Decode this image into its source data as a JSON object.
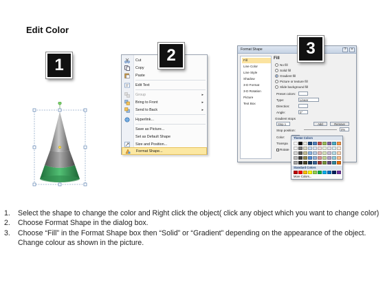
{
  "page": {
    "title": "Edit Color"
  },
  "badges": [
    "1",
    "2",
    "3"
  ],
  "colors": {
    "badge_bg": "#111111",
    "cone_grey": "#8a8a8a",
    "cone_green": "#3aa05a",
    "menu_highlight": "#fce8a2"
  },
  "context_menu": {
    "items": [
      {
        "label": "Cut",
        "icon": "scissors-icon",
        "disabled": false,
        "submenu": false
      },
      {
        "label": "Copy",
        "icon": "copy-icon",
        "disabled": false,
        "submenu": false
      },
      {
        "label": "Paste",
        "icon": "paste-icon",
        "disabled": false,
        "submenu": false
      },
      {
        "label": "Edit Text",
        "icon": "edit-text-icon",
        "disabled": false,
        "submenu": false
      },
      {
        "label": "Group",
        "icon": "group-icon",
        "disabled": true,
        "submenu": true
      },
      {
        "label": "Bring to Front",
        "icon": "bring-front-icon",
        "disabled": false,
        "submenu": true
      },
      {
        "label": "Send to Back",
        "icon": "send-back-icon",
        "disabled": false,
        "submenu": true
      },
      {
        "label": "Hyperlink...",
        "icon": "hyperlink-icon",
        "disabled": false,
        "submenu": false
      },
      {
        "label": "Save as Picture...",
        "icon": "",
        "disabled": false,
        "submenu": false
      },
      {
        "label": "Set as Default Shape",
        "icon": "",
        "disabled": false,
        "submenu": false
      },
      {
        "label": "Size and Position...",
        "icon": "size-icon",
        "disabled": false,
        "submenu": false
      },
      {
        "label": "Format Shape...",
        "icon": "format-shape-icon",
        "disabled": false,
        "submenu": false,
        "highlight": true
      }
    ]
  },
  "dialog": {
    "title": "Format Shape",
    "categories": [
      "Fill",
      "Line Color",
      "Line Style",
      "Shadow",
      "3-D Format",
      "3-D Rotation",
      "Picture",
      "Text Box"
    ],
    "active_category": "Fill",
    "fill_heading": "Fill",
    "fill_options": [
      "No fill",
      "Solid fill",
      "Gradient fill",
      "Picture or texture fill",
      "Slide background fill"
    ],
    "selected_fill": "Gradient fill",
    "preset_colors_label": "Preset colors:",
    "type_label": "Type:",
    "type_value": "Linear",
    "direction_label": "Direction:",
    "angle_label": "Angle:",
    "angle_value": "0°",
    "gradient_stops_label": "Gradient stops",
    "stop_value": "Stop 1",
    "add_label": "Add",
    "remove_label": "Remove",
    "stop_position_label": "Stop position:",
    "stop_position_value": "0%",
    "color_label": "Color:",
    "transparency_label": "Transpa",
    "rotate_label": "Rotate"
  },
  "palette": {
    "theme_label": "Theme Colors",
    "standard_label": "Standard Colors",
    "more_label": "More Colors...",
    "theme_top": [
      "#ffffff",
      "#000000",
      "#eeece1",
      "#1f497d",
      "#4f81bd",
      "#c0504d",
      "#9bbb59",
      "#8064a2",
      "#4bacc6",
      "#f79646"
    ],
    "theme_shades": [
      [
        "#f2f2f2",
        "#7f7f7f",
        "#ddd9c3",
        "#c6d9f0",
        "#dbe5f1",
        "#f2dcdb",
        "#ebf1dd",
        "#e5e0ec",
        "#dbeef3",
        "#fdeada"
      ],
      [
        "#d8d8d8",
        "#595959",
        "#c4bd97",
        "#8db3e2",
        "#b8cce4",
        "#e5b9b7",
        "#d7e3bc",
        "#ccc1d9",
        "#b7dde8",
        "#fbd5b5"
      ],
      [
        "#bfbfbf",
        "#3f3f3f",
        "#938953",
        "#548dd4",
        "#95b3d7",
        "#d99694",
        "#c3d69b",
        "#b2a2c7",
        "#92cddc",
        "#fac08f"
      ],
      [
        "#a5a5a5",
        "#262626",
        "#494429",
        "#17365d",
        "#366092",
        "#953734",
        "#76923c",
        "#5f497a",
        "#31859b",
        "#e36c09"
      ]
    ],
    "standard": [
      "#c00000",
      "#ff0000",
      "#ffc000",
      "#ffff00",
      "#92d050",
      "#00b050",
      "#00b0f0",
      "#0070c0",
      "#002060",
      "#7030a0"
    ]
  },
  "instructions": [
    {
      "num": "1.",
      "text": "Select the shape to change the color and Right click the object( click any object which you want to change color)"
    },
    {
      "num": "2.",
      "text": "Choose Format Shape in the dialog box."
    },
    {
      "num": "3.",
      "text": "Choose “Fill” in the Format Shape box then “Solid” or “Gradient” depending on the appearance of the object. Change colour as shown in the picture."
    }
  ]
}
